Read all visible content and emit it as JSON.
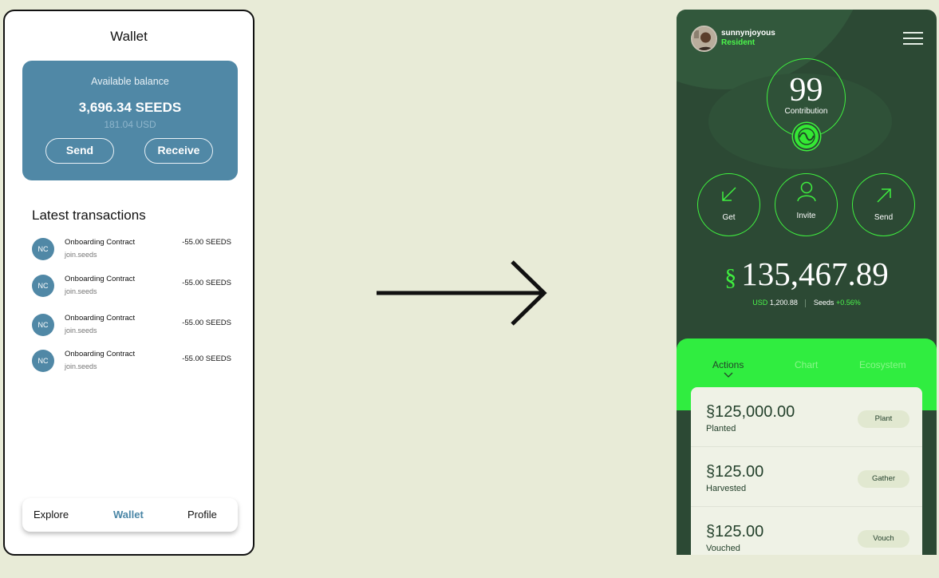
{
  "wireframe": {
    "title": "Wallet",
    "balance": {
      "label": "Available balance",
      "amount": "3,696.34 SEEDS",
      "usd": "181.04 USD",
      "send_label": "Send",
      "receive_label": "Receive"
    },
    "transactions_heading": "Latest transactions",
    "transactions": [
      {
        "initials": "NC",
        "name": "Onboarding Contract",
        "account": "join.seeds",
        "amount": "-55.00 SEEDS"
      },
      {
        "initials": "NC",
        "name": "Onboarding Contract",
        "account": "join.seeds",
        "amount": "-55.00 SEEDS"
      },
      {
        "initials": "NC",
        "name": "Onboarding Contract",
        "account": "join.seeds",
        "amount": "-55.00 SEEDS"
      },
      {
        "initials": "NC",
        "name": "Onboarding Contract",
        "account": "join.seeds",
        "amount": "-55.00 SEEDS"
      }
    ],
    "nav": {
      "explore": "Explore",
      "wallet": "Wallet",
      "profile": "Profile"
    }
  },
  "design": {
    "user": {
      "name": "sunnynjoyous",
      "role": "Resident"
    },
    "contribution": {
      "value": "99",
      "label": "Contribution"
    },
    "actions": {
      "get": "Get",
      "invite": "Invite",
      "send": "Send"
    },
    "balance": {
      "symbol": "§",
      "amount": "135,467.89",
      "usd_label": "USD",
      "usd_value": "1,200.88",
      "seeds_label": "Seeds",
      "seeds_change": "+0.56%"
    },
    "tabs": {
      "actions": "Actions",
      "chart": "Chart",
      "ecosystem": "Ecosystem"
    },
    "action_rows": [
      {
        "amount": "§125,000.00",
        "label": "Planted",
        "button": "Plant"
      },
      {
        "amount": "§125.00",
        "label": "Harvested",
        "button": "Gather"
      },
      {
        "amount": "§125.00",
        "label": "Vouched",
        "button": "Vouch"
      }
    ]
  },
  "colors": {
    "background": "#e8ebd7",
    "wireframe_accent": "#5088a6",
    "design_dark": "#2c4934",
    "design_green": "#30ed40"
  }
}
